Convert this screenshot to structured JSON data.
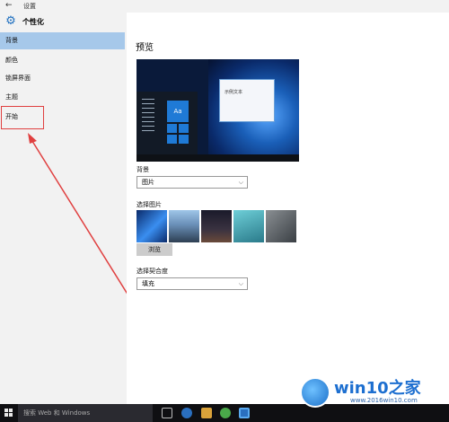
{
  "titlebar": {
    "back": "←",
    "title": "设置"
  },
  "header": {
    "title": "个性化"
  },
  "sidebar": {
    "items": [
      {
        "label": "背景"
      },
      {
        "label": "颜色"
      },
      {
        "label": "锁屏界面"
      },
      {
        "label": "主题"
      },
      {
        "label": "开始"
      }
    ],
    "active_index": 0,
    "highlighted_index": 4
  },
  "main": {
    "section_title": "预览",
    "preview": {
      "tile_text": "Aa",
      "window_text": "示例文本"
    },
    "background_label": "背景",
    "background_value": "图片",
    "choose_picture_label": "选择图片",
    "browse_label": "浏览",
    "fit_label": "选择契合度",
    "fit_value": "填充"
  },
  "taskbar": {
    "search_placeholder": "搜索 Web 和 Windows"
  },
  "watermark": {
    "text": "win10之家",
    "url": "www.2016win10.com"
  },
  "colors": {
    "accent": "#a6c8ea",
    "highlight": "#e04040",
    "brand": "#1d6fd0"
  }
}
